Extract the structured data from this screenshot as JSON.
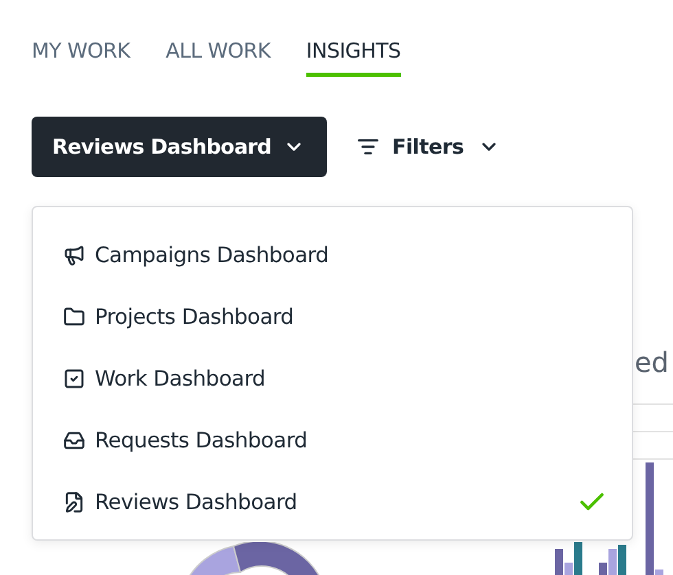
{
  "tabs": [
    {
      "label": "MY WORK",
      "selected": false
    },
    {
      "label": "ALL WORK",
      "selected": false
    },
    {
      "label": "INSIGHTS",
      "selected": true
    }
  ],
  "dashboard_button": {
    "label": "Reviews Dashboard"
  },
  "filters_button": {
    "label": "Filters"
  },
  "dropdown": {
    "items": [
      {
        "kind": "campaign",
        "label": "Campaigns Dashboard",
        "selected": false
      },
      {
        "kind": "project",
        "label": "Projects Dashboard",
        "selected": false
      },
      {
        "kind": "work",
        "label": "Work Dashboard",
        "selected": false
      },
      {
        "kind": "request",
        "label": "Requests Dashboard",
        "selected": false
      },
      {
        "kind": "review",
        "label": "Reviews Dashboard",
        "selected": true
      }
    ]
  },
  "background_card": {
    "title": "ed"
  }
}
